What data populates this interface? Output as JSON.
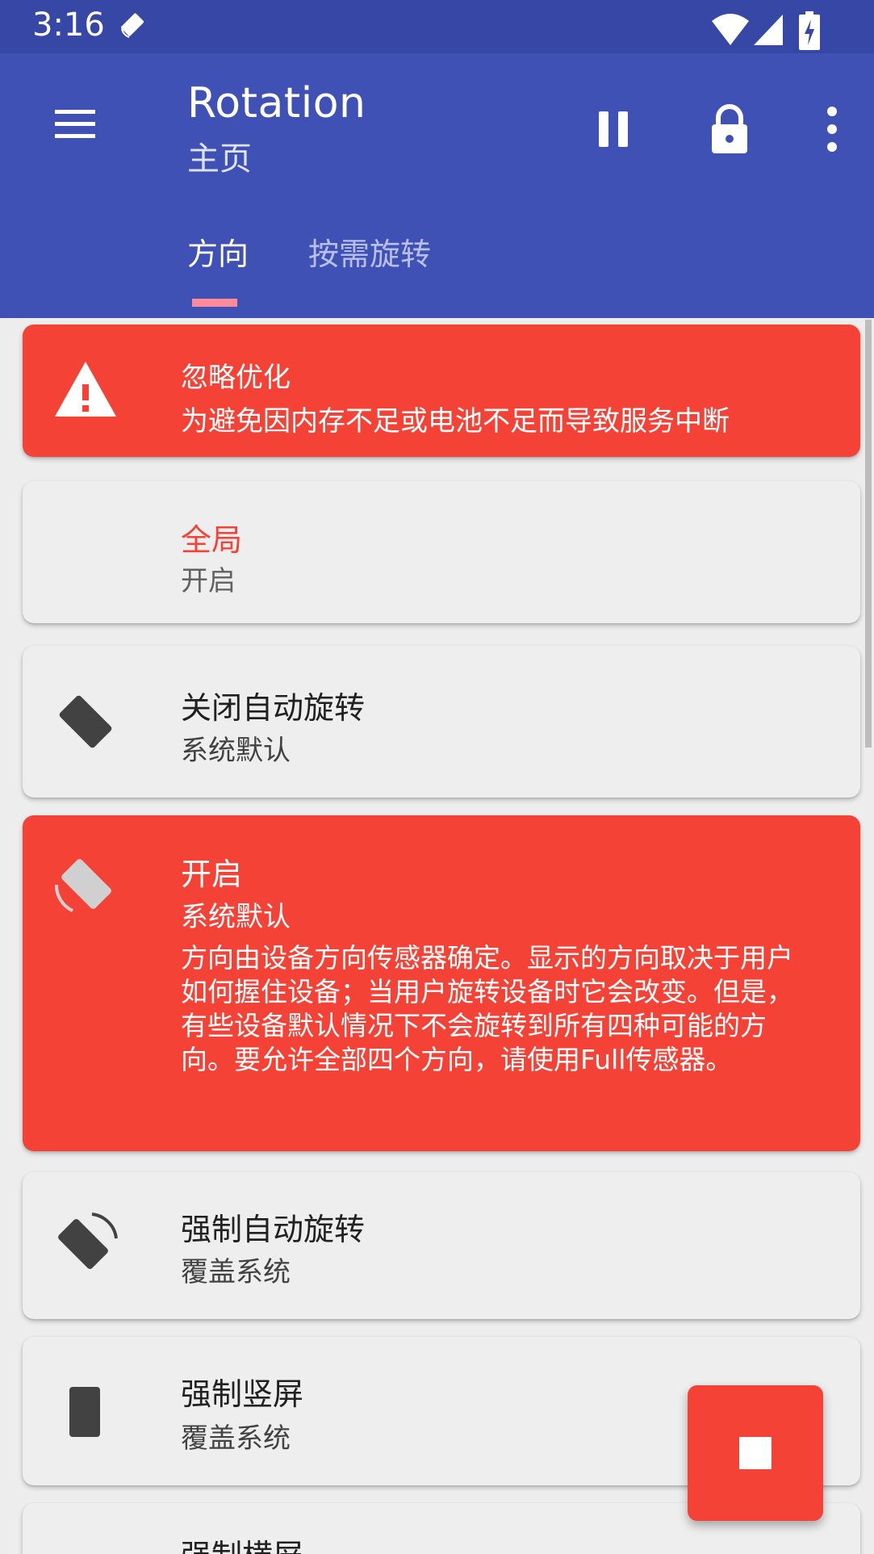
{
  "status_bar": {
    "time": "3:16"
  },
  "app_bar": {
    "title": "Rotation",
    "subtitle": "主页",
    "tabs": [
      {
        "label": "方向",
        "selected": true
      },
      {
        "label": "按需旋转",
        "selected": false
      }
    ]
  },
  "cards": {
    "ignore_optimization": {
      "title": "忽略优化",
      "subtitle": "为避免因内存不足或电池不足而导致服务中断"
    },
    "global": {
      "title": "全局",
      "subtitle": "开启"
    },
    "auto_rotate_off": {
      "title": "关闭自动旋转",
      "subtitle": "系统默认"
    },
    "auto_rotate_on": {
      "title": "开启",
      "subtitle": "系统默认",
      "description": "方向由设备方向传感器确定。显示的方向取决于用户如何握住设备；当用户旋转设备时它会改变。但是，有些设备默认情况下不会旋转到所有四种可能的方向。要允许全部四个方向，请使用Full传感器。"
    },
    "force_auto_rotate": {
      "title": "强制自动旋转",
      "subtitle": "覆盖系统"
    },
    "force_portrait": {
      "title": "强制竖屏",
      "subtitle": "覆盖系统"
    },
    "force_landscape": {
      "title": "强制横屏"
    }
  },
  "icons": {
    "status_app": "rotation-app-icon",
    "wifi": "wifi-icon",
    "signal": "cell-signal-icon",
    "battery": "battery-charging-icon",
    "menu": "hamburger-menu-icon",
    "pause": "pause-icon",
    "lock": "lock-icon",
    "more": "more-vert-icon",
    "warning": "warning-triangle-icon",
    "auto_off": "screen-rotation-off-icon",
    "auto_on": "screen-rotation-icon",
    "force_auto": "screen-rotation-force-icon",
    "portrait": "phone-portrait-icon",
    "fab": "stop-icon"
  },
  "colors": {
    "primary": "#3f51b5",
    "primary_dark": "#3747a6",
    "accent": "#f44336",
    "background": "#ededed"
  }
}
